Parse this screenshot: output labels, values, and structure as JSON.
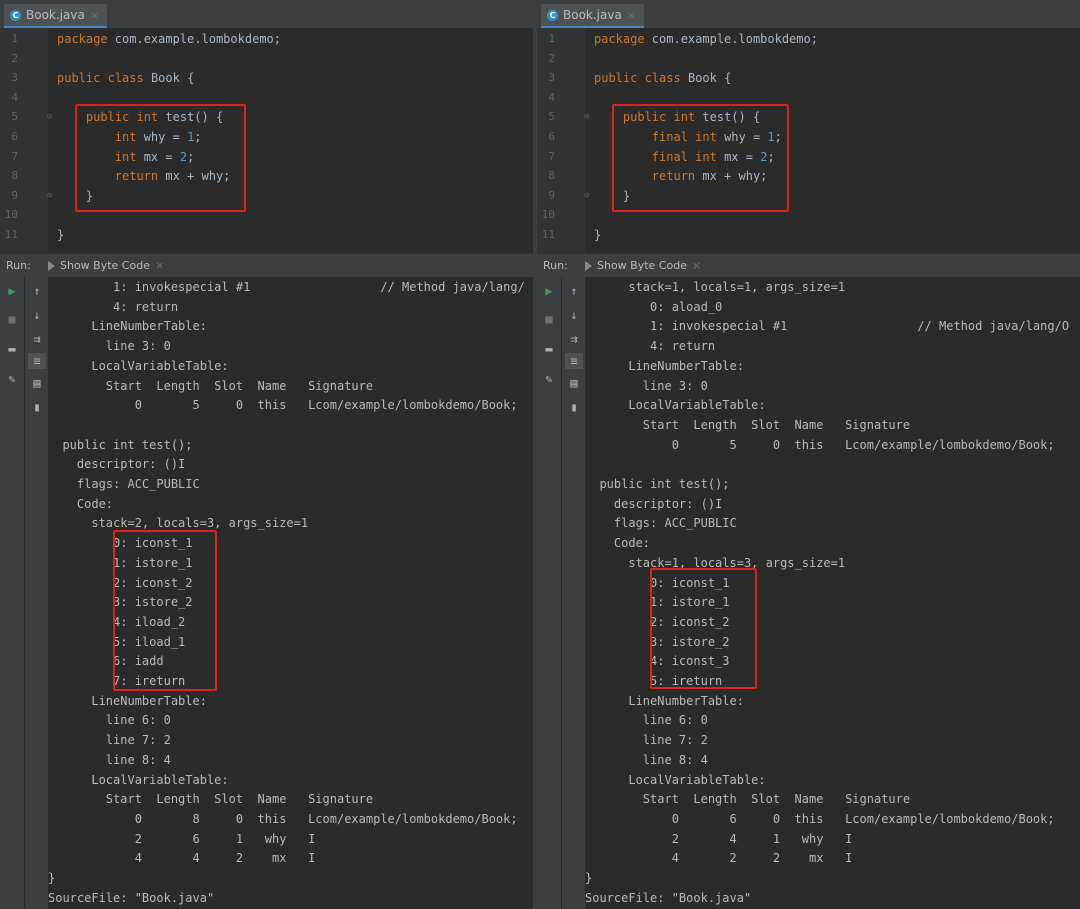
{
  "left": {
    "tab": {
      "icon": "class-icon",
      "label": "Book.java",
      "close": "×"
    },
    "editor": {
      "line_numbers": [
        "1",
        "2",
        "3",
        "4",
        "5",
        "6",
        "7",
        "8",
        "9",
        "10",
        "11"
      ],
      "lines": [
        [
          "package com.example.lombokdemo;"
        ],
        [
          ""
        ],
        [
          "public class Book {"
        ],
        [
          ""
        ],
        [
          "    public int test() {"
        ],
        [
          "        int why = 1;"
        ],
        [
          "        int mx = 2;"
        ],
        [
          "        return mx + why;"
        ],
        [
          "    }"
        ],
        [
          ""
        ],
        [
          "}"
        ]
      ]
    },
    "run": {
      "label": "Run:",
      "tab": "Show Byte Code",
      "close": "×"
    },
    "output": [
      "         1: invokespecial #1                  // Method java/lang/",
      "         4: return",
      "      LineNumberTable:",
      "        line 3: 0",
      "      LocalVariableTable:",
      "        Start  Length  Slot  Name   Signature",
      "            0       5     0  this   Lcom/example/lombokdemo/Book;",
      "",
      "  public int test();",
      "    descriptor: ()I",
      "    flags: ACC_PUBLIC",
      "    Code:",
      "      stack=2, locals=3, args_size=1",
      "         0: iconst_1",
      "         1: istore_1",
      "         2: iconst_2",
      "         3: istore_2",
      "         4: iload_2",
      "         5: iload_1",
      "         6: iadd",
      "         7: ireturn",
      "      LineNumberTable:",
      "        line 6: 0",
      "        line 7: 2",
      "        line 8: 4",
      "      LocalVariableTable:",
      "        Start  Length  Slot  Name   Signature",
      "            0       8     0  this   Lcom/example/lombokdemo/Book;",
      "            2       6     1   why   I",
      "            4       4     2    mx   I",
      "}",
      "SourceFile: \"Book.java\""
    ]
  },
  "right": {
    "tab": {
      "icon": "class-icon",
      "label": "Book.java",
      "close": "×"
    },
    "editor": {
      "line_numbers": [
        "1",
        "2",
        "3",
        "4",
        "5",
        "6",
        "7",
        "8",
        "9",
        "10",
        "11"
      ],
      "lines": [
        [
          "package com.example.lombokdemo;"
        ],
        [
          ""
        ],
        [
          "public class Book {"
        ],
        [
          ""
        ],
        [
          "    public int test() {"
        ],
        [
          "        final int why = 1;"
        ],
        [
          "        final int mx = 2;"
        ],
        [
          "        return mx + why;"
        ],
        [
          "    }"
        ],
        [
          ""
        ],
        [
          "}"
        ]
      ]
    },
    "run": {
      "label": "Run:",
      "tab": "Show Byte Code",
      "close": "×"
    },
    "output": [
      "      stack=1, locals=1, args_size=1",
      "         0: aload_0",
      "         1: invokespecial #1                  // Method java/lang/O",
      "         4: return",
      "      LineNumberTable:",
      "        line 3: 0",
      "      LocalVariableTable:",
      "        Start  Length  Slot  Name   Signature",
      "            0       5     0  this   Lcom/example/lombokdemo/Book;",
      "",
      "  public int test();",
      "    descriptor: ()I",
      "    flags: ACC_PUBLIC",
      "    Code:",
      "      stack=1, locals=3, args_size=1",
      "         0: iconst_1",
      "         1: istore_1",
      "         2: iconst_2",
      "         3: istore_2",
      "         4: iconst_3",
      "         5: ireturn",
      "      LineNumberTable:",
      "        line 6: 0",
      "        line 7: 2",
      "        line 8: 4",
      "      LocalVariableTable:",
      "        Start  Length  Slot  Name   Signature",
      "            0       6     0  this   Lcom/example/lombokdemo/Book;",
      "            2       4     1   why   I",
      "            4       2     2    mx   I",
      "}",
      "SourceFile: \"Book.java\""
    ]
  },
  "toolbar_icons": [
    "run-icon",
    "stop-icon",
    "layout-icon",
    "pin-icon",
    "up-arrow-icon",
    "down-arrow-icon",
    "soft-wrap-icon",
    "scroll-to-end-icon",
    "print-icon",
    "trash-icon"
  ],
  "colors": {
    "keyword": "#cc7832",
    "number": "#6897bb",
    "text": "#a9b7c6",
    "highlight_box": "#e0201a"
  }
}
